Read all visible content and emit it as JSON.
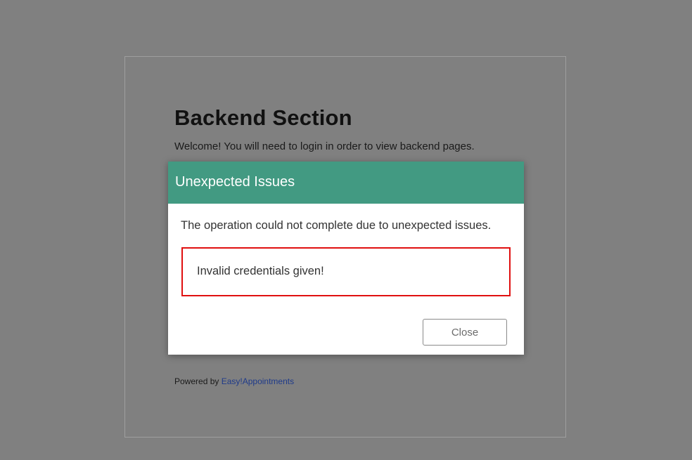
{
  "page": {
    "title": "Backend Section",
    "welcome": "Welcome! You will need to login in order to view backend pages.",
    "powered_by_prefix": "Powered by ",
    "powered_by_link": "Easy!Appointments"
  },
  "modal": {
    "title": "Unexpected Issues",
    "message": "The operation could not complete due to unexpected issues.",
    "error": "Invalid credentials given!",
    "close_label": "Close"
  },
  "colors": {
    "overlay": "#808080",
    "modal_header": "#429a82",
    "error_border": "#e01010",
    "link": "#1e3a8a"
  }
}
